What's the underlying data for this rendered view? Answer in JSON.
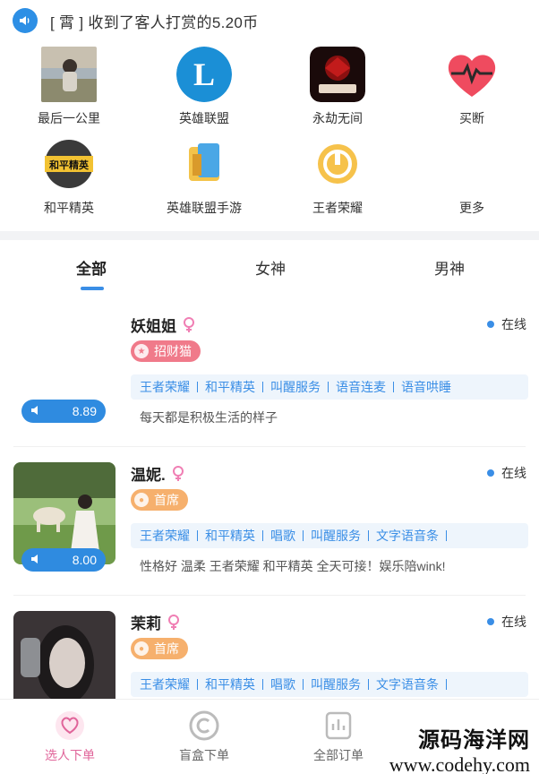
{
  "notice": {
    "text": "[ 霄 ] 收到了客人打赏的5.20币",
    "icon": "speaker-icon"
  },
  "games": [
    {
      "label": "最后一公里",
      "icon": "photo-thumb-icon"
    },
    {
      "label": "英雄联盟",
      "icon": "lol-logo-icon"
    },
    {
      "label": "永劫无间",
      "icon": "naraka-logo-icon"
    },
    {
      "label": "买断",
      "icon": "heart-pulse-icon"
    },
    {
      "label": "和平精英",
      "icon": "peace-elite-logo-icon"
    },
    {
      "label": "英雄联盟手游",
      "icon": "wild-rift-logo-icon"
    },
    {
      "label": "王者荣耀",
      "icon": "honor-of-kings-logo-icon"
    },
    {
      "label": "更多",
      "icon": "more-icon"
    }
  ],
  "tabs": [
    "全部",
    "女神",
    "男神"
  ],
  "status_online": "在线",
  "cards": [
    {
      "name": "妖姐姐",
      "badge": "招财猫",
      "tags": [
        "王者荣耀",
        "和平精英",
        "叫醒服务",
        "语音连麦",
        "语音哄睡"
      ],
      "desc": "每天都是积极生活的样子",
      "price": "8.89"
    },
    {
      "name": "温妮.",
      "badge": "首席",
      "tags": [
        "王者荣耀",
        "和平精英",
        "唱歌",
        "叫醒服务",
        "文字语音条"
      ],
      "desc": "性格好 温柔 王者荣耀 和平精英 全天可接！娱乐陪wink!",
      "price": "8.00"
    },
    {
      "name": "茉莉",
      "badge": "首席",
      "tags": [
        "王者荣耀",
        "和平精英",
        "唱歌",
        "叫醒服务",
        "文字语音条"
      ],
      "desc": "",
      "price": ""
    }
  ],
  "bottom_nav": [
    {
      "label": "选人下单",
      "icon": "heart-icon"
    },
    {
      "label": "盲盒下单",
      "icon": "blind-box-icon"
    },
    {
      "label": "全部订单",
      "icon": "orders-icon"
    }
  ],
  "watermark": {
    "line1": "源码海洋网",
    "line2": "www.codehy.com"
  },
  "colors": {
    "accent": "#3a8ee6",
    "pink": "#e0659a",
    "badge_red": "#f07a8a",
    "badge_orange": "#f6b06d"
  }
}
